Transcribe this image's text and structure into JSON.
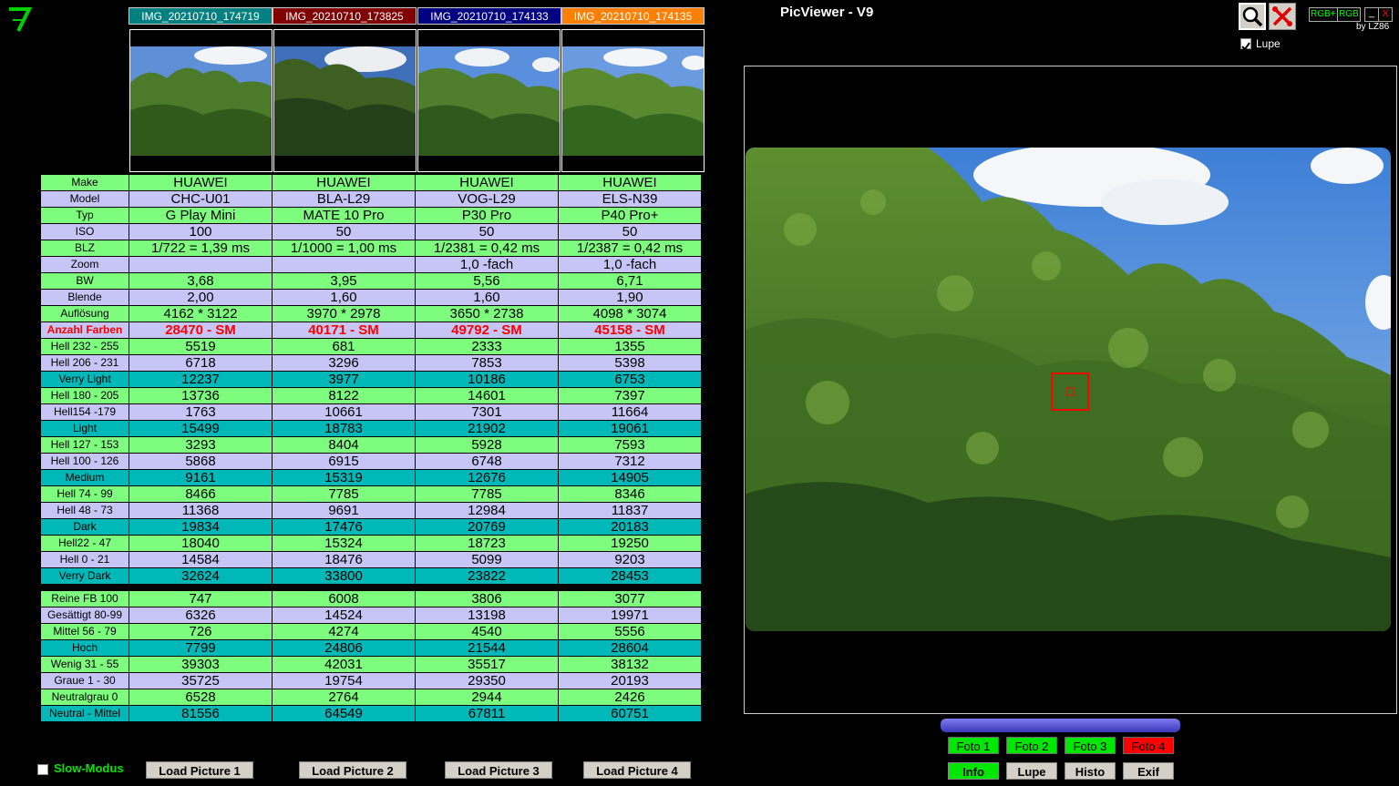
{
  "app": {
    "title": "PicViewer - V9",
    "byline": "by LZ86",
    "rgb_plus_label": "RGB+",
    "rgb_label": "RGB",
    "min_label": "_",
    "close_label": "X",
    "lupe_label": "Lupe",
    "lupe_checked": true,
    "slow_label": "Slow-Modus"
  },
  "tabs": [
    {
      "label": "IMG_20210710_174719",
      "color": "#008080"
    },
    {
      "label": "IMG_20210710_173825",
      "color": "#800000"
    },
    {
      "label": "IMG_20210710_174133",
      "color": "#000080"
    },
    {
      "label": "IMG_20210710_174135",
      "color": "#ff8000"
    }
  ],
  "rows": [
    {
      "label": "Make",
      "style": "g",
      "values": [
        "HUAWEI",
        "HUAWEI",
        "HUAWEI",
        "HUAWEI"
      ]
    },
    {
      "label": "Model",
      "style": "l",
      "values": [
        "CHC-U01",
        "BLA-L29",
        "VOG-L29",
        "ELS-N39"
      ]
    },
    {
      "label": "Typ",
      "style": "g",
      "values": [
        "G Play Mini",
        "MATE 10 Pro",
        "P30 Pro",
        "P40 Pro+"
      ]
    },
    {
      "label": "ISO",
      "style": "l",
      "values": [
        "100",
        "50",
        "50",
        "50"
      ]
    },
    {
      "label": "BLZ",
      "style": "g",
      "values": [
        "1/722 = 1,39 ms",
        "1/1000 = 1,00 ms",
        "1/2381 = 0,42 ms",
        "1/2387 = 0,42 ms"
      ]
    },
    {
      "label": "Zoom",
      "style": "l",
      "values": [
        "",
        "",
        "1,0 -fach",
        "1,0 -fach"
      ]
    },
    {
      "label": "BW",
      "style": "g",
      "values": [
        "3,68",
        "3,95",
        "5,56",
        "6,71"
      ]
    },
    {
      "label": "Blende",
      "style": "l",
      "values": [
        "2,00",
        "1,60",
        "1,60",
        "1,90"
      ]
    },
    {
      "label": "Auflösung",
      "style": "g",
      "values": [
        "4162 * 3122",
        "3970 * 2978",
        "3650 * 2738",
        "4098 * 3074"
      ]
    },
    {
      "label": "Anzahl Farben",
      "style": "red",
      "values": [
        "28470 - SM",
        "40171 - SM",
        "49792 - SM",
        "45158 - SM"
      ]
    },
    {
      "label": "Hell 232 - 255",
      "style": "g",
      "values": [
        "5519",
        "681",
        "2333",
        "1355"
      ]
    },
    {
      "label": "Hell 206 - 231",
      "style": "l",
      "values": [
        "6718",
        "3296",
        "7853",
        "5398"
      ]
    },
    {
      "label": "Verry Light",
      "style": "c",
      "values": [
        "12237",
        "3977",
        "10186",
        "6753"
      ]
    },
    {
      "label": "Hell 180 - 205",
      "style": "g",
      "values": [
        "13736",
        "8122",
        "14601",
        "7397"
      ]
    },
    {
      "label": "Hell154 -179",
      "style": "l",
      "values": [
        "1763",
        "10661",
        "7301",
        "11664"
      ]
    },
    {
      "label": "Light",
      "style": "c",
      "values": [
        "15499",
        "18783",
        "21902",
        "19061"
      ]
    },
    {
      "label": "Hell 127 - 153",
      "style": "g",
      "values": [
        "3293",
        "8404",
        "5928",
        "7593"
      ]
    },
    {
      "label": "Hell 100 - 126",
      "style": "l",
      "values": [
        "5868",
        "6915",
        "6748",
        "7312"
      ]
    },
    {
      "label": "Medium",
      "style": "c",
      "values": [
        "9161",
        "15319",
        "12676",
        "14905"
      ]
    },
    {
      "label": "Hell 74 - 99",
      "style": "g",
      "values": [
        "8466",
        "7785",
        "7785",
        "8346"
      ]
    },
    {
      "label": "Hell 48 - 73",
      "style": "l",
      "values": [
        "11368",
        "9691",
        "12984",
        "11837"
      ]
    },
    {
      "label": "Dark",
      "style": "c",
      "values": [
        "19834",
        "17476",
        "20769",
        "20183"
      ]
    },
    {
      "label": "Hell22 - 47",
      "style": "g",
      "values": [
        "18040",
        "15324",
        "18723",
        "19250"
      ]
    },
    {
      "label": "Hell 0 - 21",
      "style": "l",
      "values": [
        "14584",
        "18476",
        "5099",
        "9203"
      ]
    },
    {
      "label": "Verry Dark",
      "style": "c",
      "values": [
        "32624",
        "33800",
        "23822",
        "28453"
      ]
    },
    {
      "label": "",
      "style": "gap",
      "values": [
        "",
        "",
        "",
        ""
      ]
    },
    {
      "label": "Reine FB 100",
      "style": "g",
      "values": [
        "747",
        "6008",
        "3806",
        "3077"
      ]
    },
    {
      "label": "Gesättigt 80-99",
      "style": "l",
      "values": [
        "6326",
        "14524",
        "13198",
        "19971"
      ]
    },
    {
      "label": "Mittel 56 - 79",
      "style": "g",
      "values": [
        "726",
        "4274",
        "4540",
        "5556"
      ]
    },
    {
      "label": "Hoch",
      "style": "c",
      "values": [
        "7799",
        "24806",
        "21544",
        "28604"
      ]
    },
    {
      "label": "Wenig 31 - 55",
      "style": "g",
      "values": [
        "39303",
        "42031",
        "35517",
        "38132"
      ]
    },
    {
      "label": "Graue 1 - 30",
      "style": "l",
      "values": [
        "35725",
        "19754",
        "29350",
        "20193"
      ]
    },
    {
      "label": "Neutralgrau 0",
      "style": "g",
      "values": [
        "6528",
        "2764",
        "2944",
        "2426"
      ]
    },
    {
      "label": "Neutral - Mittel",
      "style": "c",
      "values": [
        "81556",
        "64549",
        "67811",
        "60751"
      ]
    }
  ],
  "load_buttons": [
    "Load Picture 1",
    "Load Picture 2",
    "Load Picture 3",
    "Load Picture 4"
  ],
  "foto_buttons": [
    {
      "label": "Foto 1",
      "color": "#00e600"
    },
    {
      "label": "Foto 2",
      "color": "#00e600"
    },
    {
      "label": "Foto 3",
      "color": "#00e600"
    },
    {
      "label": "Foto 4",
      "color": "#ff0000"
    }
  ],
  "view_buttons": [
    {
      "label": "Info",
      "color": "#00e600"
    },
    {
      "label": "Lupe",
      "color": "#d4d0c8"
    },
    {
      "label": "Histo",
      "color": "#d4d0c8"
    },
    {
      "label": "Exif",
      "color": "#d4d0c8"
    }
  ],
  "icons": {
    "logo": "seven-logo-icon",
    "magnifier": "magnifier-icon",
    "tools": "tools-icon"
  },
  "colors": {
    "row_green": "#7dfc7d",
    "row_lilac": "#c7c4f6",
    "row_cyan": "#00b8b8",
    "accent_red": "#ff0000"
  }
}
